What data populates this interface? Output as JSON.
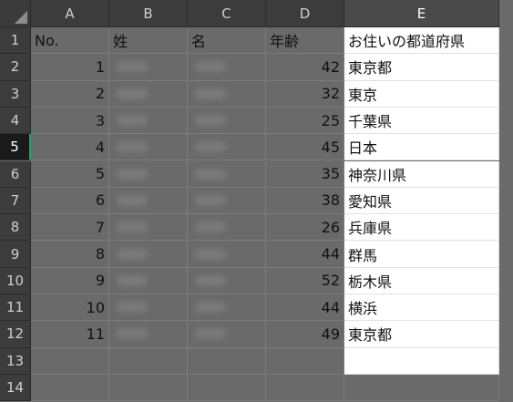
{
  "sheet": {
    "columns": [
      "A",
      "B",
      "C",
      "D",
      "E"
    ],
    "rows": [
      "1",
      "2",
      "3",
      "4",
      "5",
      "6",
      "7",
      "8",
      "9",
      "10",
      "11",
      "12",
      "13",
      "14"
    ],
    "header": {
      "no": "No.",
      "sei": "姓",
      "mei": "名",
      "age": "年齢",
      "pref": "お住いの都道府県"
    },
    "data": [
      {
        "no": "1",
        "age": "42",
        "pref": "東京都"
      },
      {
        "no": "2",
        "age": "32",
        "pref": "東京"
      },
      {
        "no": "3",
        "age": "25",
        "pref": "千葉県"
      },
      {
        "no": "4",
        "age": "45",
        "pref": "日本"
      },
      {
        "no": "5",
        "age": "35",
        "pref": "神奈川県"
      },
      {
        "no": "6",
        "age": "38",
        "pref": "愛知県"
      },
      {
        "no": "7",
        "age": "26",
        "pref": "兵庫県"
      },
      {
        "no": "8",
        "age": "44",
        "pref": "群馬"
      },
      {
        "no": "9",
        "age": "52",
        "pref": "栃木県"
      },
      {
        "no": "10",
        "age": "44",
        "pref": "横浜"
      },
      {
        "no": "11",
        "age": "49",
        "pref": "東京都"
      }
    ],
    "active_row": "5",
    "selected_column": "E"
  }
}
